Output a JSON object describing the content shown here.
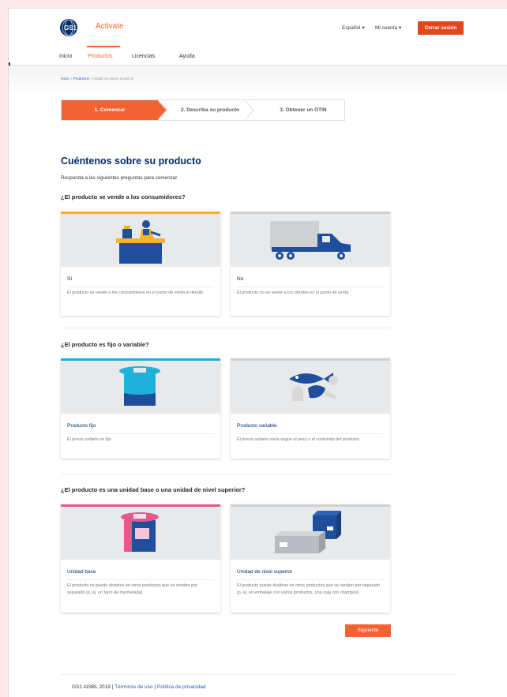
{
  "header": {
    "brand_logo_text": "GS1",
    "app_name": "Activate",
    "language_label": "Español",
    "account_label": "Mi cuenta",
    "logout_label": "Cerrar sesión"
  },
  "nav": {
    "items": [
      {
        "label": "Inicio",
        "active": false
      },
      {
        "label": "Productos",
        "active": true
      },
      {
        "label": "Licencias",
        "active": false
      },
      {
        "label": "Ayuda",
        "active": false
      }
    ]
  },
  "breadcrumb": {
    "home": "Inicio",
    "products": "Productos",
    "current": "Añadir un nuevo producto",
    "separator": ">"
  },
  "steps": {
    "step1": "1. Comenzar",
    "step2": "2. Describa su producto",
    "step3": "3. Obtener un GTIN",
    "active_index": 0
  },
  "main": {
    "title": "Cuéntenos sobre su producto",
    "intro": "Responda a las siguientes preguntas para comenzar."
  },
  "questions": [
    {
      "question": "¿El producto se vende a los consumidores?",
      "options": [
        {
          "title": "Sí",
          "description": "El producto se vende a los consumidores en el punto de venta al detalle",
          "icon": "checkout-counter-icon",
          "selected": true,
          "accent": "#f4b22f"
        },
        {
          "title": "No",
          "description": "El producto no se vende a los clientes en el punto de venta",
          "icon": "delivery-truck-icon",
          "selected": false,
          "accent": "#cfd0d2"
        }
      ]
    },
    {
      "question": "¿El producto es fijo o variable?",
      "options": [
        {
          "title": "Producto fijo",
          "description": "El precio unitario es fijo",
          "icon": "fixed-product-cup-icon",
          "selected": true,
          "accent": "#1fb1d9"
        },
        {
          "title": "Producto variable",
          "description": "El precio unitario varía según el peso o el contenido del producto",
          "icon": "variable-product-fish-meat-icon",
          "selected": false,
          "accent": "#cfd0d2"
        }
      ]
    },
    {
      "question": "¿El producto es una unidad base o una unidad de nivel superior?",
      "options": [
        {
          "title": "Unidad base",
          "description": "El producto no puede dividirse en otros productos que se venden por separado (p. ej. un tarro de mermelada)",
          "icon": "base-unit-jar-icon",
          "selected": true,
          "accent": "#e8578b"
        },
        {
          "title": "Unidad de nivel superior",
          "description": "El producto puede dividirse en otros productos que se venden por separado (p. ej. un embalaje con varios productos, una caja con champús)",
          "icon": "higher-level-boxes-icon",
          "selected": false,
          "accent": "#cfd0d2"
        }
      ]
    }
  ],
  "actions": {
    "next_label": "Siguiente"
  },
  "footer": {
    "copyright": "GS1 AISBL 2019",
    "separator": "|",
    "terms": "Términos de uso",
    "privacy": "Política de privacidad"
  },
  "colors": {
    "accent": "#f26334",
    "navy": "#002c6c",
    "link": "#1d5db3"
  }
}
